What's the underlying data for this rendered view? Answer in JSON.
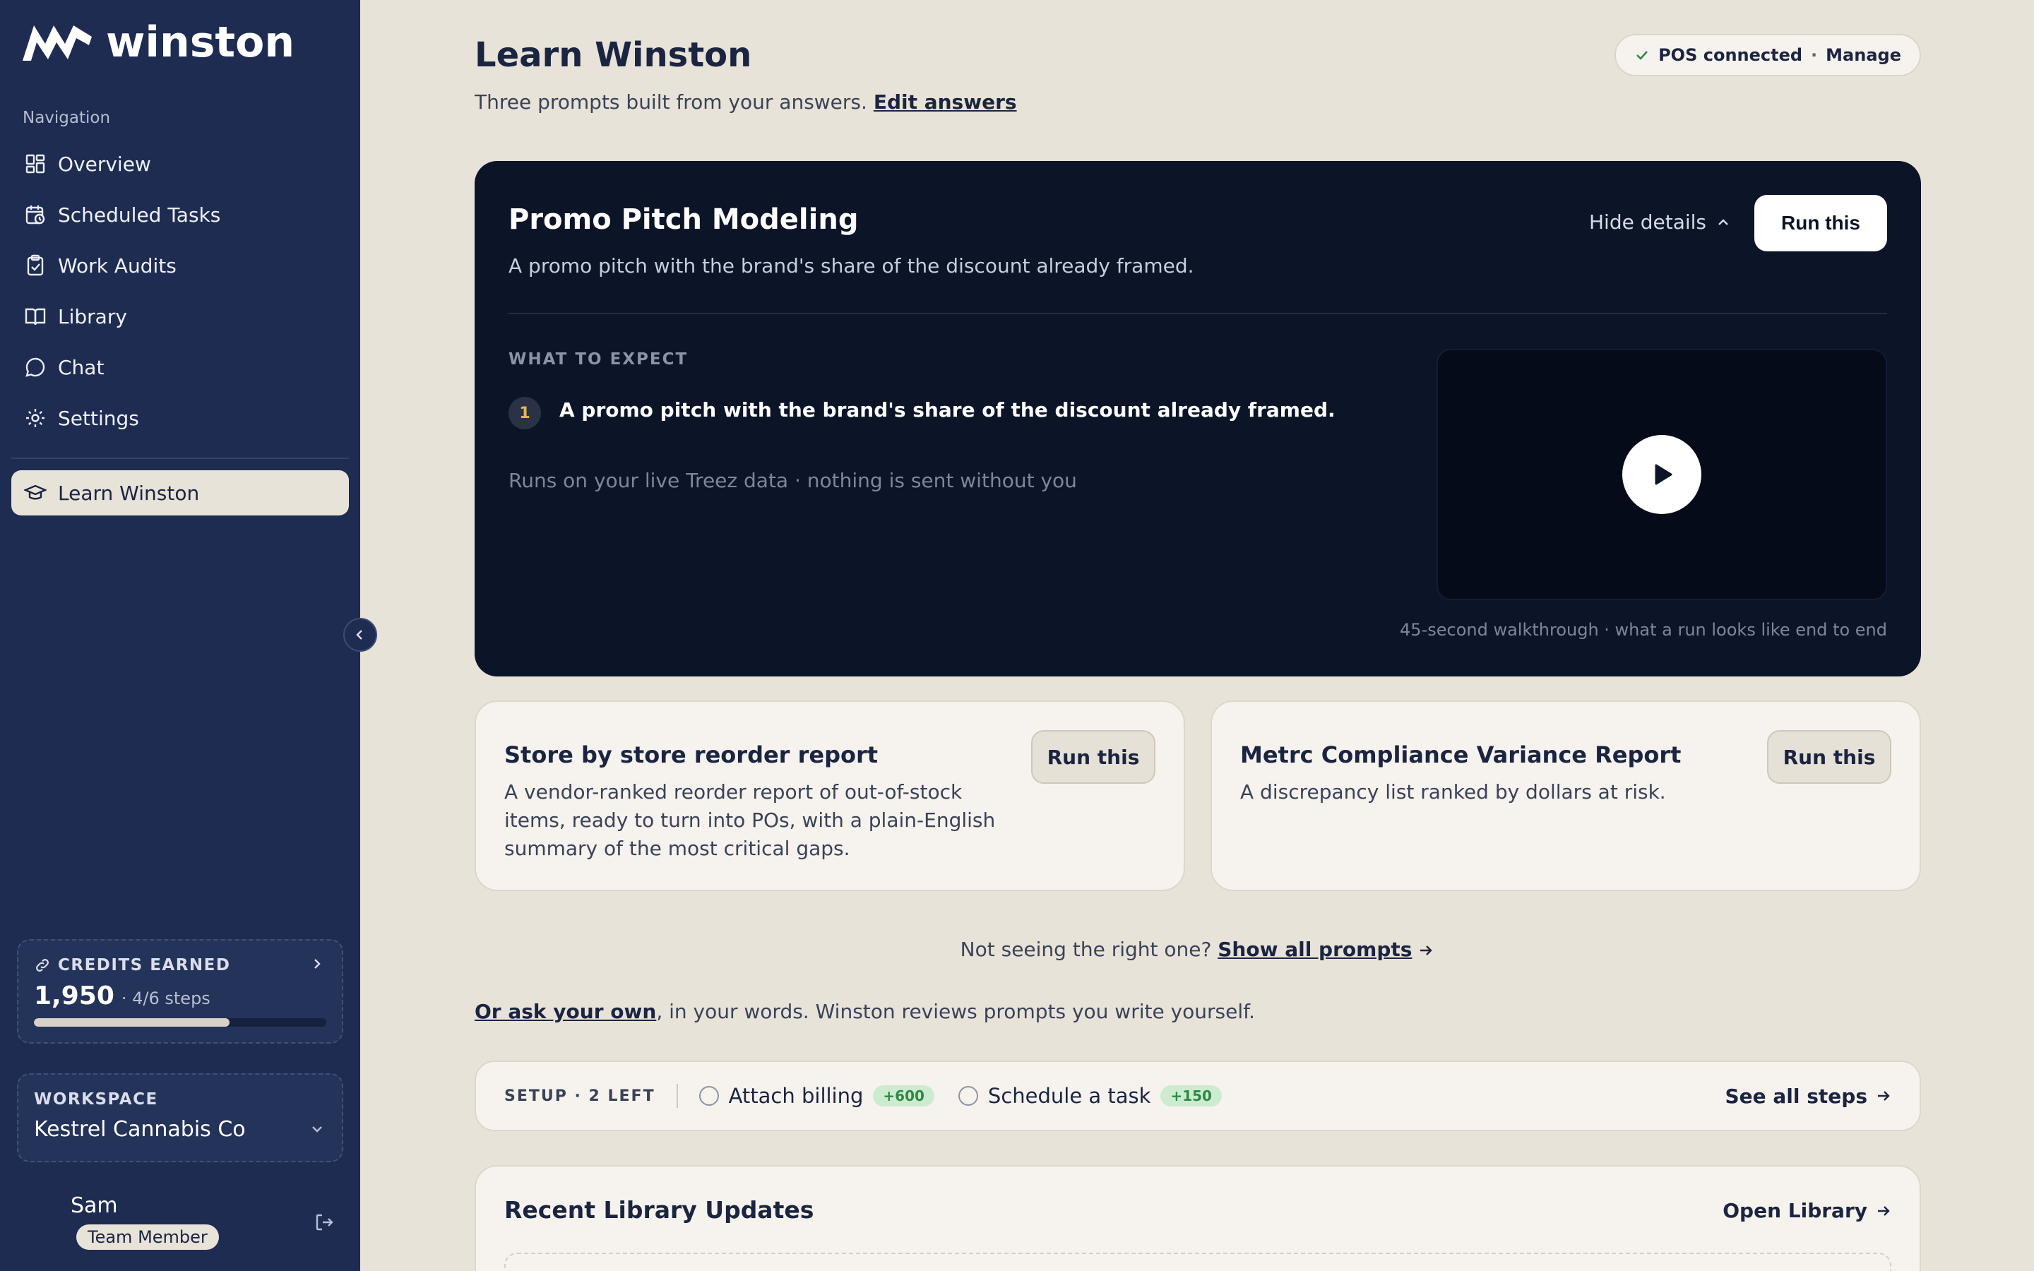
{
  "brand": {
    "name": "winston"
  },
  "sidebar": {
    "nav_heading": "Navigation",
    "items": [
      {
        "label": "Overview",
        "icon": "dashboard-icon"
      },
      {
        "label": "Scheduled Tasks",
        "icon": "calendar-clock-icon"
      },
      {
        "label": "Work Audits",
        "icon": "clipboard-check-icon"
      },
      {
        "label": "Library",
        "icon": "book-open-icon"
      },
      {
        "label": "Chat",
        "icon": "chat-bubble-icon"
      },
      {
        "label": "Settings",
        "icon": "gear-icon"
      }
    ],
    "active_item": {
      "label": "Learn Winston",
      "icon": "graduation-cap-icon"
    },
    "credits": {
      "label": "CREDITS EARNED",
      "value": "1,950",
      "steps": "· 4/6 steps",
      "progress_percent": 67
    },
    "workspace": {
      "label": "WORKSPACE",
      "name": "Kestrel Cannabis Co"
    },
    "user": {
      "name": "Sam",
      "role": "Team Member"
    }
  },
  "header": {
    "title": "Learn Winston",
    "subtitle": "Three prompts built from your answers.",
    "edit_link": "Edit answers",
    "pos_status": "POS connected",
    "pos_separator": "·",
    "pos_manage": "Manage"
  },
  "hero": {
    "title": "Promo Pitch Modeling",
    "description": "A promo pitch with the brand's share of the discount already framed.",
    "hide_details": "Hide details",
    "run_label": "Run this",
    "expect_label": "WHAT TO EXPECT",
    "step_number": "1",
    "step_text": "A promo pitch with the brand's share of the discount already framed.",
    "runs_note": "Runs on your live Treez data · nothing is sent without you",
    "video_caption": "45-second walkthrough · what a run looks like end to end"
  },
  "prompts": [
    {
      "title": "Store by store reorder report",
      "description": "A vendor-ranked reorder report of out-of-stock items, ready to turn into POs, with a plain-English summary of the most critical gaps.",
      "run_label": "Run this"
    },
    {
      "title": "Metrc Compliance Variance Report",
      "description": "A discrepancy list ranked by dollars at risk.",
      "run_label": "Run this"
    }
  ],
  "more": {
    "question": "Not seeing the right one?",
    "show_all": "Show all prompts",
    "ask_link": "Or ask your own",
    "ask_rest": ", in your words. Winston reviews prompts you write yourself."
  },
  "setup": {
    "label": "SETUP · 2 LEFT",
    "steps": [
      {
        "label": "Attach billing",
        "bonus": "+600"
      },
      {
        "label": "Schedule a task",
        "bonus": "+150"
      }
    ],
    "see_all": "See all steps"
  },
  "recent": {
    "title": "Recent Library Updates",
    "open_link": "Open Library"
  },
  "colors": {
    "sidebar_bg": "#1e2c52",
    "page_bg": "#e8e3d9",
    "hero_bg": "#0c1428",
    "card_bg": "#f6f3ee",
    "success_green": "#2d8a46"
  }
}
